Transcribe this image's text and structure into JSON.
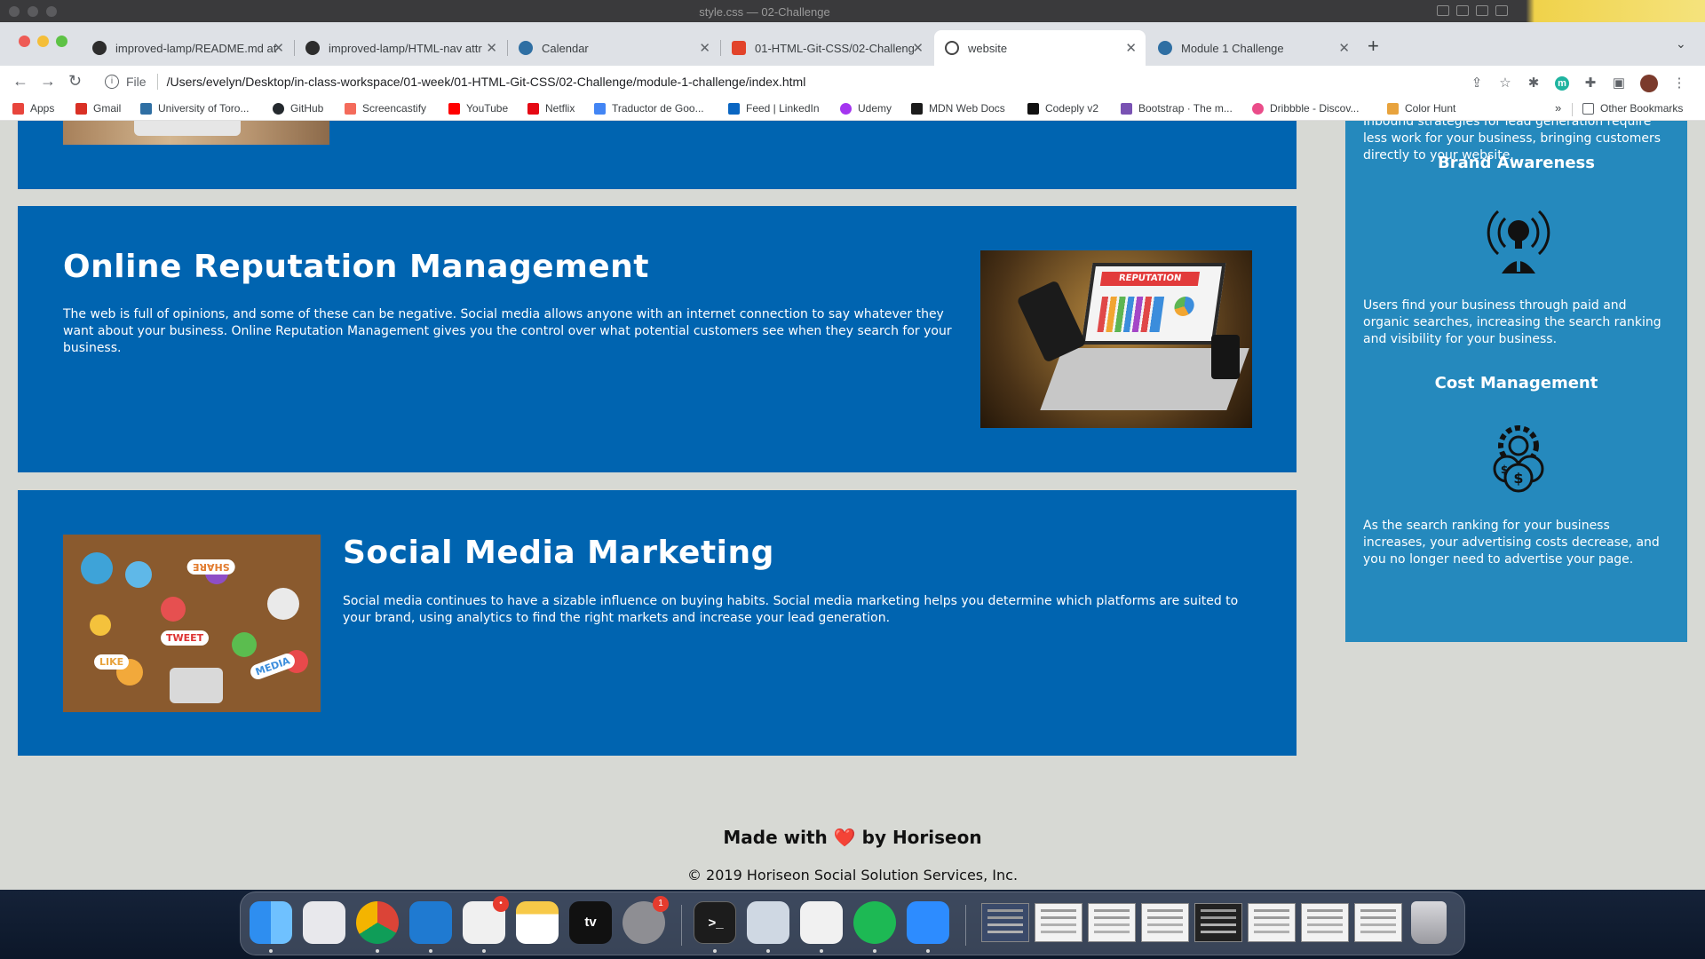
{
  "editor_window": {
    "title": "style.css — 02-Challenge"
  },
  "browser": {
    "tabs": [
      {
        "label": "improved-lamp/README.md at",
        "icon": "github-icon",
        "active": false
      },
      {
        "label": "improved-lamp/HTML-nav attr",
        "icon": "github-icon",
        "active": false
      },
      {
        "label": "Calendar",
        "icon": "umbrella-icon",
        "active": false
      },
      {
        "label": "01-HTML-Git-CSS/02-Challeng",
        "icon": "gitlab-icon",
        "active": false
      },
      {
        "label": "website",
        "icon": "globe-icon",
        "active": true
      },
      {
        "label": "Module 1 Challenge",
        "icon": "umbrella-icon",
        "active": false
      }
    ],
    "new_tab": "+",
    "address": {
      "scheme_label": "File",
      "url": "/Users/evelyn/Desktop/in-class-workspace/01-week/01-HTML-Git-CSS/02-Challenge/module-1-challenge/index.html"
    },
    "bookmarks": [
      {
        "label": "Apps",
        "icon": "apps-grid-icon",
        "color": "#e8453c"
      },
      {
        "label": "Gmail",
        "icon": "gmail-icon",
        "color": "#d93025"
      },
      {
        "label": "University of Toro...",
        "icon": "umbrella-icon",
        "color": "#2f6fa3"
      },
      {
        "label": "GitHub",
        "icon": "github-icon",
        "color": "#24292e"
      },
      {
        "label": "Screencastify",
        "icon": "screencastify-icon",
        "color": "#f46b5b"
      },
      {
        "label": "YouTube",
        "icon": "youtube-icon",
        "color": "#ff0000"
      },
      {
        "label": "Netflix",
        "icon": "netflix-icon",
        "color": "#e50914"
      },
      {
        "label": "Traductor de Goo...",
        "icon": "google-translate-icon",
        "color": "#4285f4"
      },
      {
        "label": "Feed | LinkedIn",
        "icon": "linkedin-icon",
        "color": "#0a66c2"
      },
      {
        "label": "Udemy",
        "icon": "udemy-icon",
        "color": "#a435f0"
      },
      {
        "label": "MDN Web Docs",
        "icon": "mdn-icon",
        "color": "#1b1b1b"
      },
      {
        "label": "Codeply v2",
        "icon": "codeply-icon",
        "color": "#111111"
      },
      {
        "label": "Bootstrap · The m...",
        "icon": "bootstrap-icon",
        "color": "#7952b3"
      },
      {
        "label": "Dribbble - Discov...",
        "icon": "dribbble-icon",
        "color": "#ea4c89"
      },
      {
        "label": "Color Hunt",
        "icon": "color-hunt-icon",
        "color": "#e8a33d"
      }
    ],
    "bookmarks_overflow": "»",
    "other_bookmarks": "Other Bookmarks"
  },
  "page": {
    "sections": [
      {
        "id": "online-reputation-management",
        "title": "Online Reputation Management",
        "body": "The web is full of opinions, and some of these can be negative. Social media allows anyone with an internet connection to say whatever they want about your business. Online Reputation Management gives you the control over what potential customers see when they search for your business.",
        "image_text": "REPUTATION"
      },
      {
        "id": "social-media-marketing",
        "title": "Social Media Marketing",
        "body": "Social media continues to have a sizable influence on buying habits. Social media marketing helps you determine which platforms are suited to your brand, using analytics to find the right markets and increase your lead generation.",
        "image_words": [
          "SHARE",
          "TWEET",
          "LIKE",
          "MEDIA"
        ]
      }
    ],
    "benefits": {
      "lead_text_partial": "Inbound strategies for lead generation require less work for your business, bringing customers directly to your website.",
      "items": [
        {
          "title": "Brand Awareness",
          "icon": "brand-awareness-icon",
          "body": "Users find your business through paid and organic searches, increasing the search ranking and visibility for your business."
        },
        {
          "title": "Cost Management",
          "icon": "cost-management-icon",
          "body": "As the search ranking for your business increases, your advertising costs decrease, and you no longer need to advertise your page."
        }
      ]
    },
    "footer": {
      "made_with_prefix": "Made with",
      "heart": "❤️",
      "made_with_suffix": "by Horiseon",
      "copyright": "© 2019 Horiseon Social Solution Services, Inc."
    },
    "colors": {
      "card": "#0064b0",
      "sidebar": "#2589bd",
      "background": "#d7d9d4"
    }
  },
  "dock": {
    "apps": [
      "finder",
      "launchpad",
      "chrome",
      "vscode",
      "slack",
      "notes",
      "apple-tv",
      "system-preferences",
      "terminal",
      "preview",
      "textedit",
      "spotify",
      "zoom"
    ],
    "badges": {
      "slack": "•",
      "system-preferences": "1"
    },
    "apple_tv_label": "tv"
  }
}
